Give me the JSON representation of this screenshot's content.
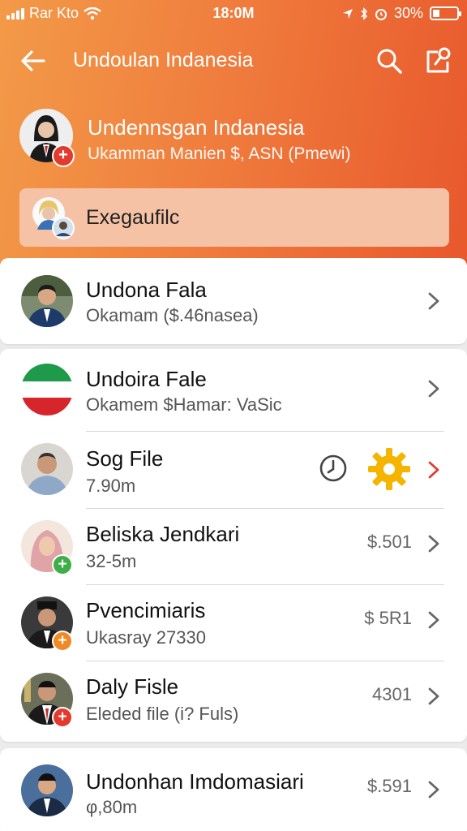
{
  "status_bar": {
    "carrier": "Rar Kto",
    "time": "18:0M",
    "battery": "30%",
    "battery_level": 0.3
  },
  "nav": {
    "title": "Undoulan Indanesia",
    "back_icon": "arrow-left-icon",
    "search_icon": "search-icon",
    "share_icon": "share-icon"
  },
  "profile": {
    "name": "Undennsgan Indanesia",
    "subtitle": "Ukamman Manien  $, ASN (Pmewi)"
  },
  "banner": {
    "label": "Exegaufilc"
  },
  "rows": [
    {
      "title": "Undona Fala",
      "subtitle": "Okamam ($.46nasea)",
      "value": ""
    },
    {
      "title": "Undoira Fale",
      "subtitle": "Okamem $Hamar: VaSic",
      "value": ""
    },
    {
      "title": "Sog File",
      "subtitle": "7.90m",
      "value": ""
    },
    {
      "title": "Beliska Jendkari",
      "subtitle": "32-5m",
      "value": "$.501"
    },
    {
      "title": "Pvencimiaris",
      "subtitle": "Ukasray 27330",
      "value": "$ 5R1"
    },
    {
      "title": "Daly Fisle",
      "subtitle": "Eleded file (i? Fuls)",
      "value": "4301"
    },
    {
      "title": "Undonhan Imdomasiari",
      "subtitle": "φ,80m",
      "value": "$.591"
    }
  ],
  "icons": {
    "clock": "clock-icon",
    "gear": "gear-icon",
    "chevron": "chevron-right-icon",
    "plus_badge": "plus-badge-icon"
  },
  "colors": {
    "header_start": "#f39a48",
    "header_end": "#e8582c",
    "accent_red": "#e23b2e",
    "badge_green": "#3fae49",
    "badge_orange": "#f08a24",
    "gear_yellow": "#f5b400"
  }
}
